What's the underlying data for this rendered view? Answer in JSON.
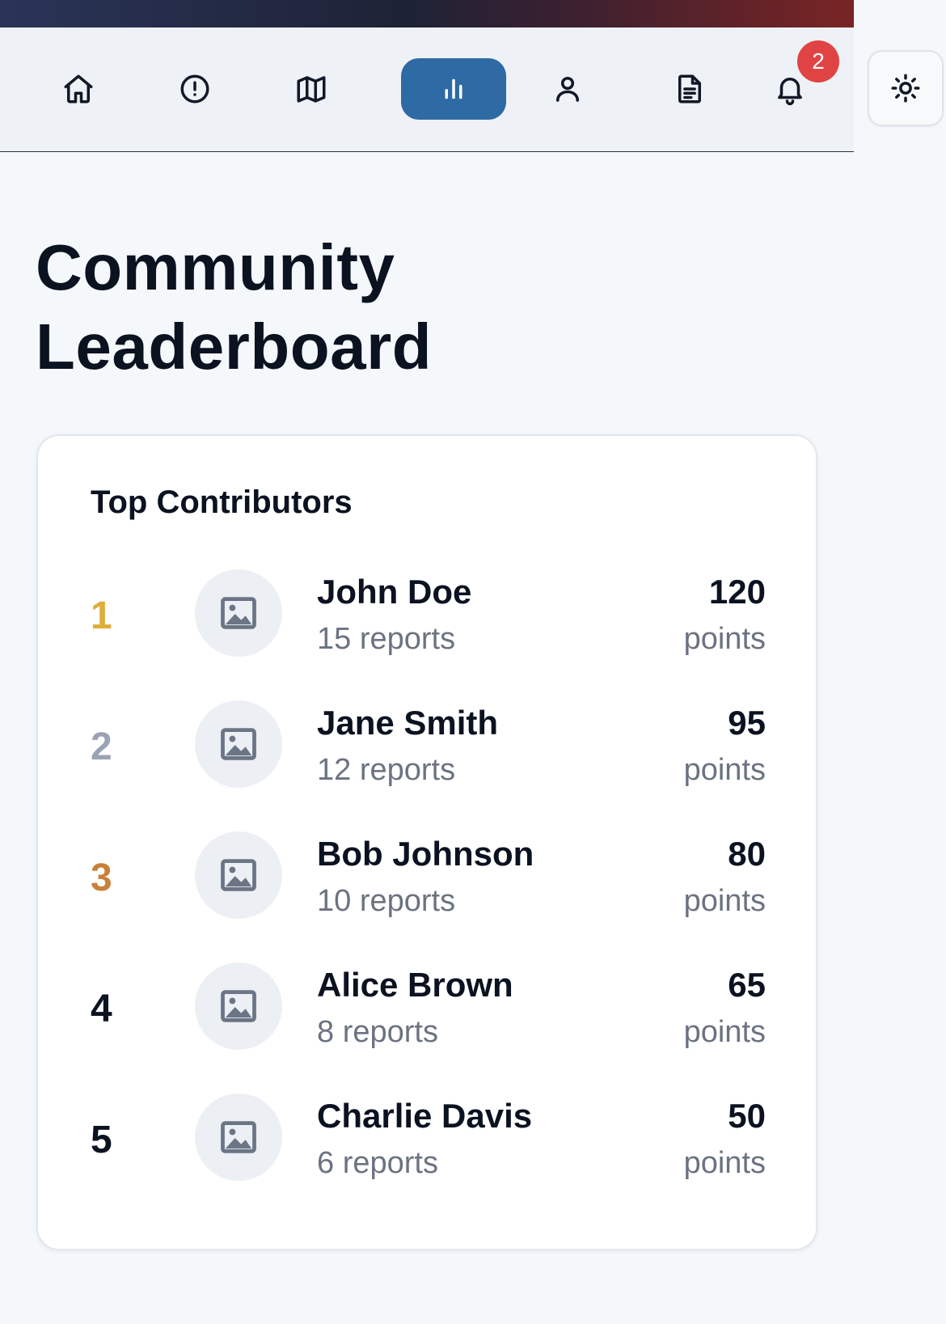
{
  "nav": {
    "items": [
      {
        "icon": "home-icon",
        "active": false
      },
      {
        "icon": "alert-circle-icon",
        "active": false
      },
      {
        "icon": "map-icon",
        "active": false
      },
      {
        "icon": "bar-chart-icon",
        "active": true
      },
      {
        "icon": "user-icon",
        "active": false
      },
      {
        "icon": "document-icon",
        "active": false
      },
      {
        "icon": "bell-icon",
        "active": false
      }
    ],
    "notification_count": "2",
    "theme_icon": "sun-icon",
    "active_color": "#2e6aa3",
    "badge_color": "#e04343"
  },
  "page": {
    "title": "Community Leaderboard"
  },
  "leaderboard": {
    "title": "Top Contributors",
    "rows": [
      {
        "rank": "1",
        "name": "John Doe",
        "reports": "15 reports",
        "points": "120",
        "points_label": "points",
        "rank_color": "#e0ac3a",
        "avatar_icon": "image-placeholder-icon"
      },
      {
        "rank": "2",
        "name": "Jane Smith",
        "reports": "12 reports",
        "points": "95",
        "points_label": "points",
        "rank_color": "#9aa3b1",
        "avatar_icon": "image-placeholder-icon"
      },
      {
        "rank": "3",
        "name": "Bob Johnson",
        "reports": "10 reports",
        "points": "80",
        "points_label": "points",
        "rank_color": "#c9803a",
        "avatar_icon": "image-placeholder-icon"
      },
      {
        "rank": "4",
        "name": "Alice Brown",
        "reports": "8 reports",
        "points": "65",
        "points_label": "points",
        "rank_color": "#0b1220",
        "avatar_icon": "image-placeholder-icon"
      },
      {
        "rank": "5",
        "name": "Charlie Davis",
        "reports": "6 reports",
        "points": "50",
        "points_label": "points",
        "rank_color": "#0b1220",
        "avatar_icon": "image-placeholder-icon"
      }
    ]
  }
}
